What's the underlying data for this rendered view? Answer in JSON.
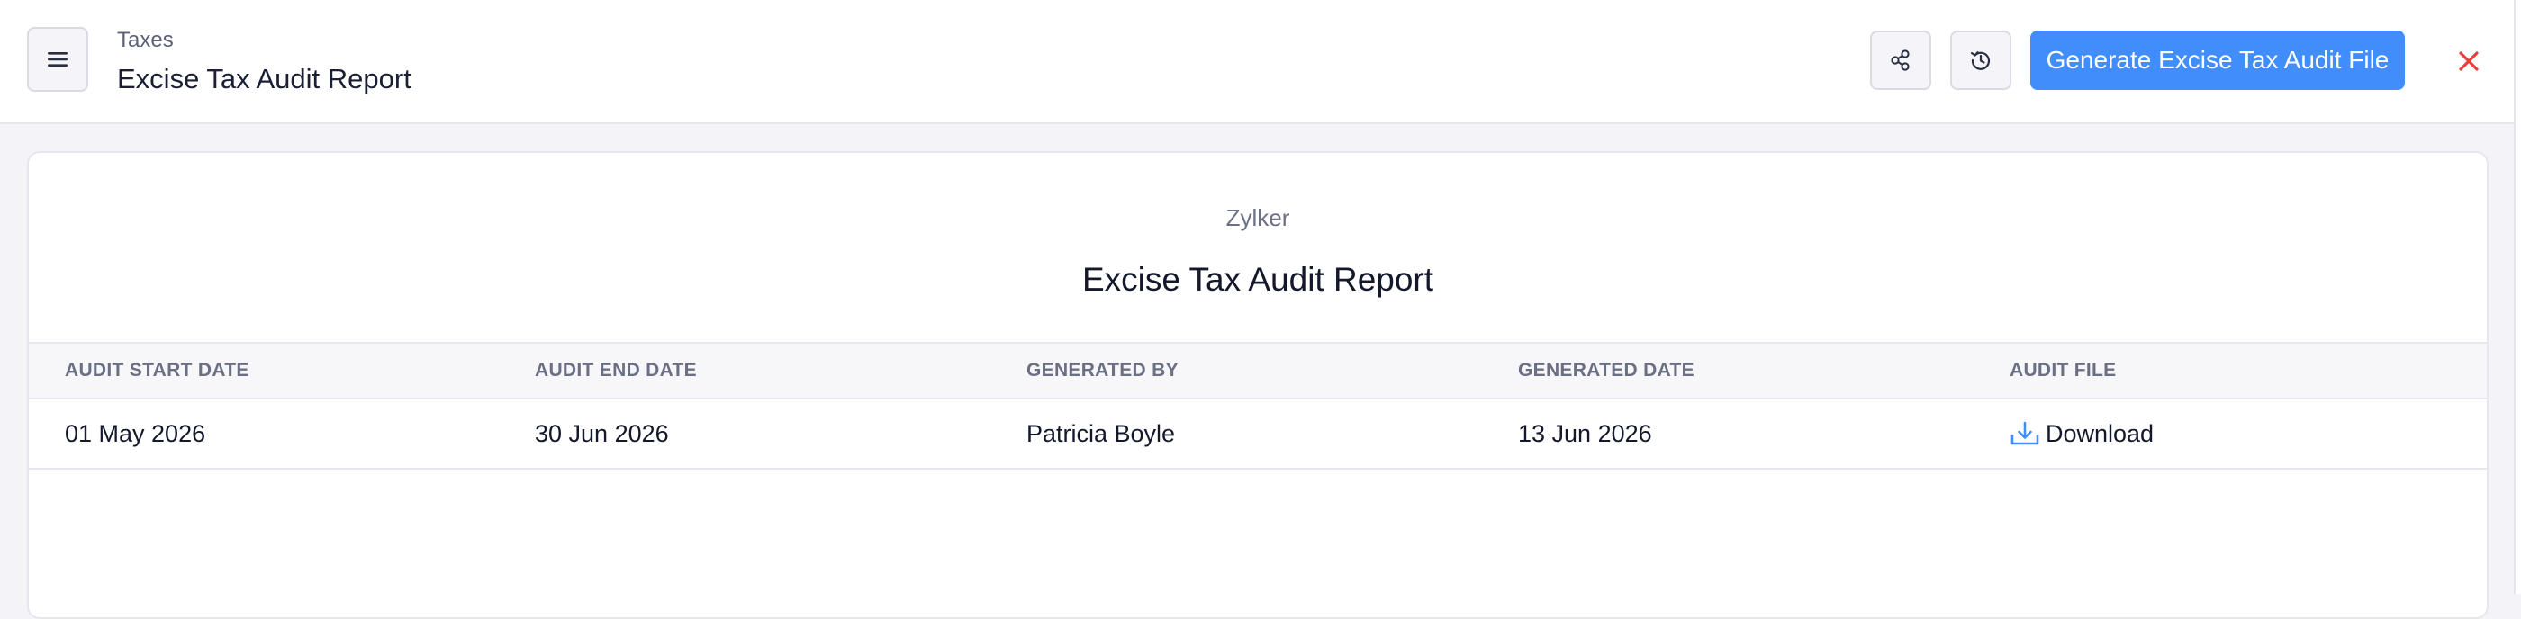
{
  "header": {
    "breadcrumb": "Taxes",
    "title": "Excise Tax Audit Report",
    "menu_icon": "hamburger-menu-icon",
    "share_icon": "share-icon",
    "history_icon": "history-icon",
    "primary_button_label": "Generate Excise Tax Audit File",
    "close_icon": "close-icon"
  },
  "report": {
    "organization": "Zylker",
    "title": "Excise Tax Audit Report",
    "columns": [
      "AUDIT START DATE",
      "AUDIT END DATE",
      "GENERATED BY",
      "GENERATED DATE",
      "AUDIT FILE"
    ],
    "rows": [
      {
        "audit_start_date": "01 May 2026",
        "audit_end_date": "30 Jun 2026",
        "generated_by": "Patricia Boyle",
        "generated_date": "13 Jun 2026",
        "audit_file_label": "Download",
        "audit_file_icon": "download-icon"
      }
    ]
  },
  "colors": {
    "primary": "#408dfb",
    "close": "#e8413c",
    "download_icon": "#408dfb"
  }
}
